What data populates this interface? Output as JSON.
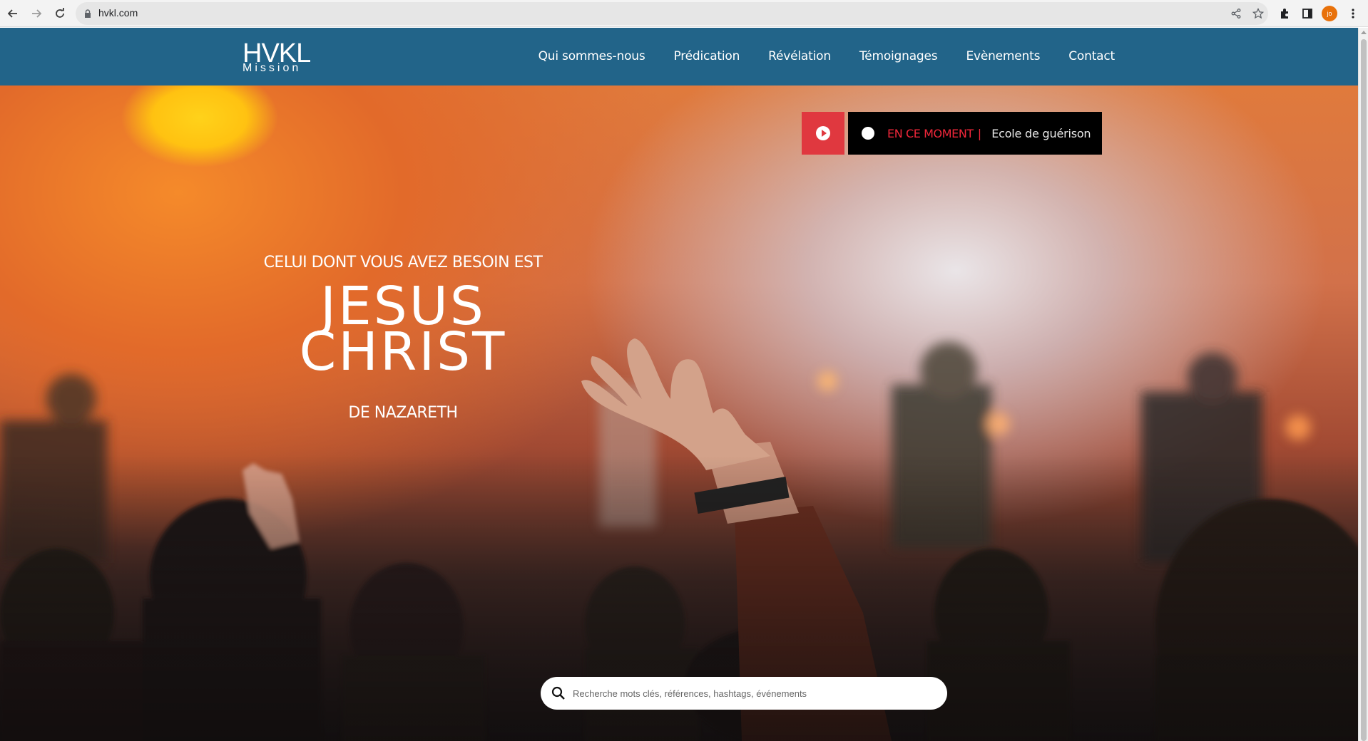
{
  "browser": {
    "url": "hvkl.com",
    "avatar_initials": "jo"
  },
  "header": {
    "logo_main": "HVKL",
    "logo_sub": "Mission",
    "menu": [
      {
        "label": "Qui sommes-nous"
      },
      {
        "label": "Prédication"
      },
      {
        "label": "Révélation"
      },
      {
        "label": "Témoignages"
      },
      {
        "label": "Evènements"
      },
      {
        "label": "Contact"
      }
    ]
  },
  "live": {
    "label": "EN CE MOMENT",
    "separator": "|",
    "value": "Ecole de guérison"
  },
  "hero": {
    "line1": "CELUI DONT VOUS AVEZ BESOIN EST",
    "line2a": "JESUS",
    "line2b": "CHRIST",
    "line3": "DE NAZARETH"
  },
  "search": {
    "placeholder": "Recherche mots clés, références, hashtags, événements"
  },
  "colors": {
    "header_bg": "#226489",
    "live_red": "#e0383f",
    "live_text": "#f0273a"
  }
}
